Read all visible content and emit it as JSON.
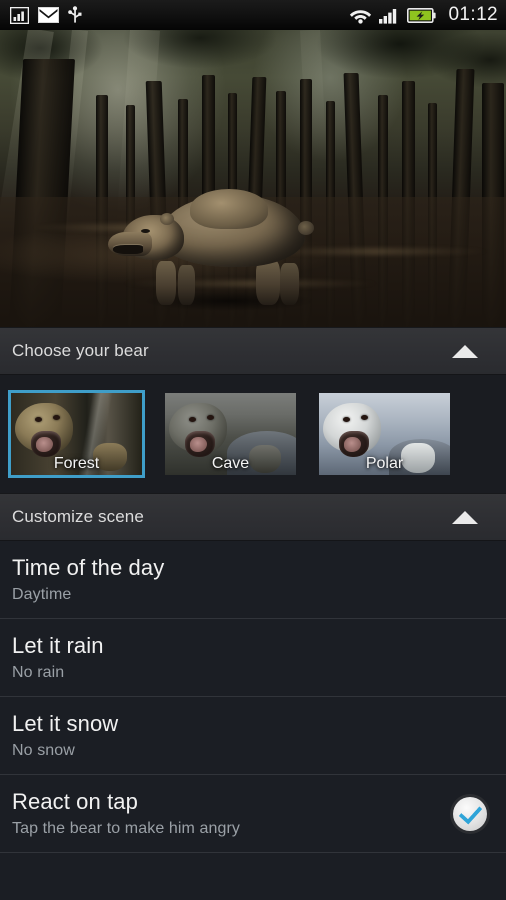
{
  "statusbar": {
    "icons_left": [
      "signal-chart-icon",
      "gmail-icon",
      "usb-icon"
    ],
    "icons_right": [
      "wifi-icon",
      "cell-signal-icon",
      "battery-charging-icon"
    ],
    "clock": "01:12"
  },
  "preview": {
    "scene_name": "forest-bear-preview",
    "subject": "bear"
  },
  "sections": [
    {
      "id": "choose-bear",
      "title": "Choose your bear",
      "expanded": true,
      "arrow": "collapse-up-arrow-icon"
    },
    {
      "id": "customize-scene",
      "title": "Customize scene",
      "expanded": true,
      "arrow": "collapse-up-arrow-icon"
    }
  ],
  "bears": [
    {
      "label": "Forest",
      "selected": true
    },
    {
      "label": "Cave",
      "selected": false
    },
    {
      "label": "Polar",
      "selected": false
    }
  ],
  "preferences": [
    {
      "title": "Time of the day",
      "summary": "Daytime",
      "has_checkbox": false
    },
    {
      "title": "Let it rain",
      "summary": "No rain",
      "has_checkbox": false
    },
    {
      "title": "Let it snow",
      "summary": "No snow",
      "has_checkbox": false
    },
    {
      "title": "React on tap",
      "summary": "Tap the bear to make him angry",
      "has_checkbox": true,
      "checked": true
    }
  ],
  "colors": {
    "selection_border": "#3f9ec9",
    "checkmark": "#2fa4d8",
    "section_header_bg": "#2e2f33",
    "list_bg": "#1b1e24",
    "title_text": "#f1f1f1",
    "summary_text": "#9aa0a6",
    "battery_green": "#8fc31f"
  }
}
